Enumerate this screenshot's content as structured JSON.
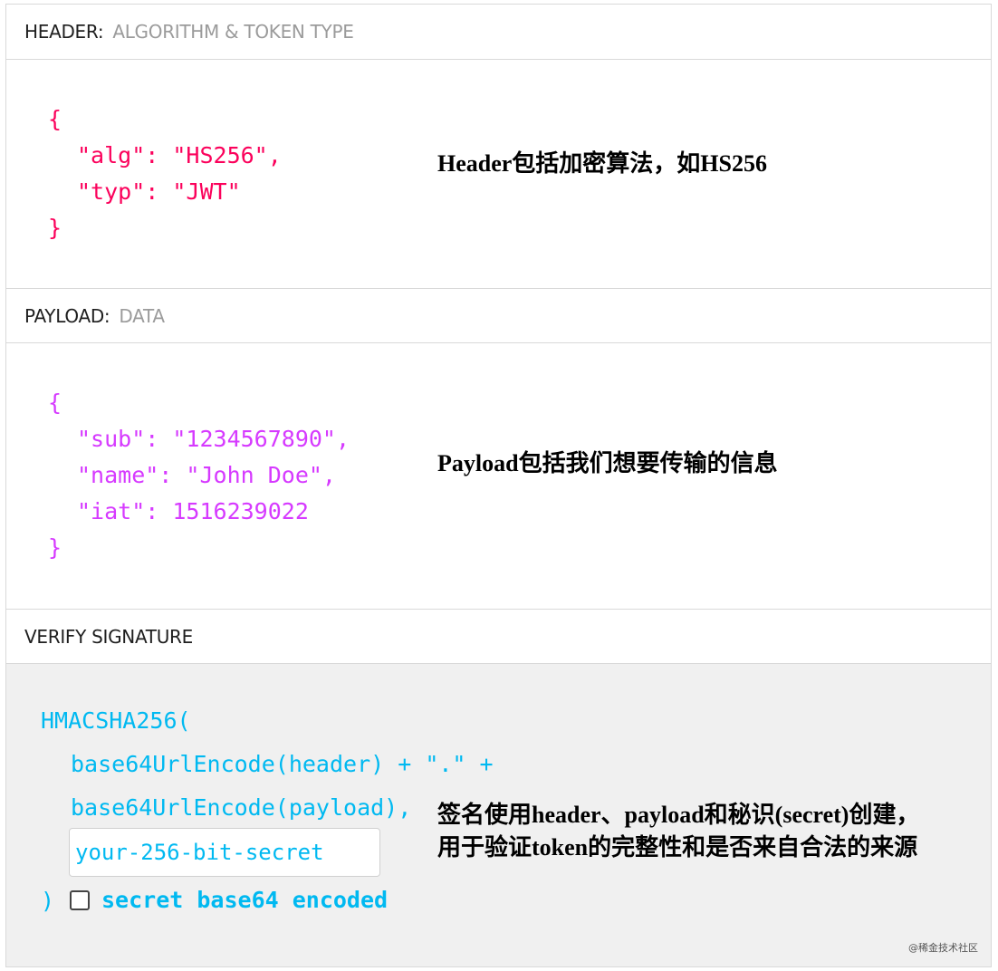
{
  "header_section": {
    "title": "HEADER:",
    "subtitle": "ALGORITHM & TOKEN TYPE",
    "code": {
      "open": "{",
      "line1_key": "\"alg\"",
      "line1_sep": ": ",
      "line1_val": "\"HS256\",",
      "line2_key": "\"typ\"",
      "line2_sep": ": ",
      "line2_val": "\"JWT\"",
      "close": "}"
    },
    "annotation": "Header包括加密算法，如HS256"
  },
  "payload_section": {
    "title": "PAYLOAD:",
    "subtitle": "DATA",
    "code": {
      "open": "{",
      "line1": "\"sub\": \"1234567890\",",
      "line2": "\"name\": \"John Doe\",",
      "line3": "\"iat\": 1516239022",
      "close": "}"
    },
    "annotation": "Payload包括我们想要传输的信息"
  },
  "signature_section": {
    "title": "VERIFY SIGNATURE",
    "code": {
      "line1": "HMACSHA256(",
      "line2": "base64UrlEncode(header) + \".\" +",
      "line3": "base64UrlEncode(payload),",
      "close": ")"
    },
    "secret_value": "your-256-bit-secret",
    "checkbox_label": "secret base64 encoded",
    "checkbox_checked": false,
    "annotation_line1": "签名使用header、payload和秘识(secret)创建，",
    "annotation_line2": "用于验证token的完整性和是否来自合法的来源"
  },
  "watermark": "@稀金技术社区",
  "colors": {
    "header_code": "#fb015b",
    "payload_code": "#d63aff",
    "signature_code": "#00b9f1",
    "signature_bg": "#f0f0f0"
  }
}
